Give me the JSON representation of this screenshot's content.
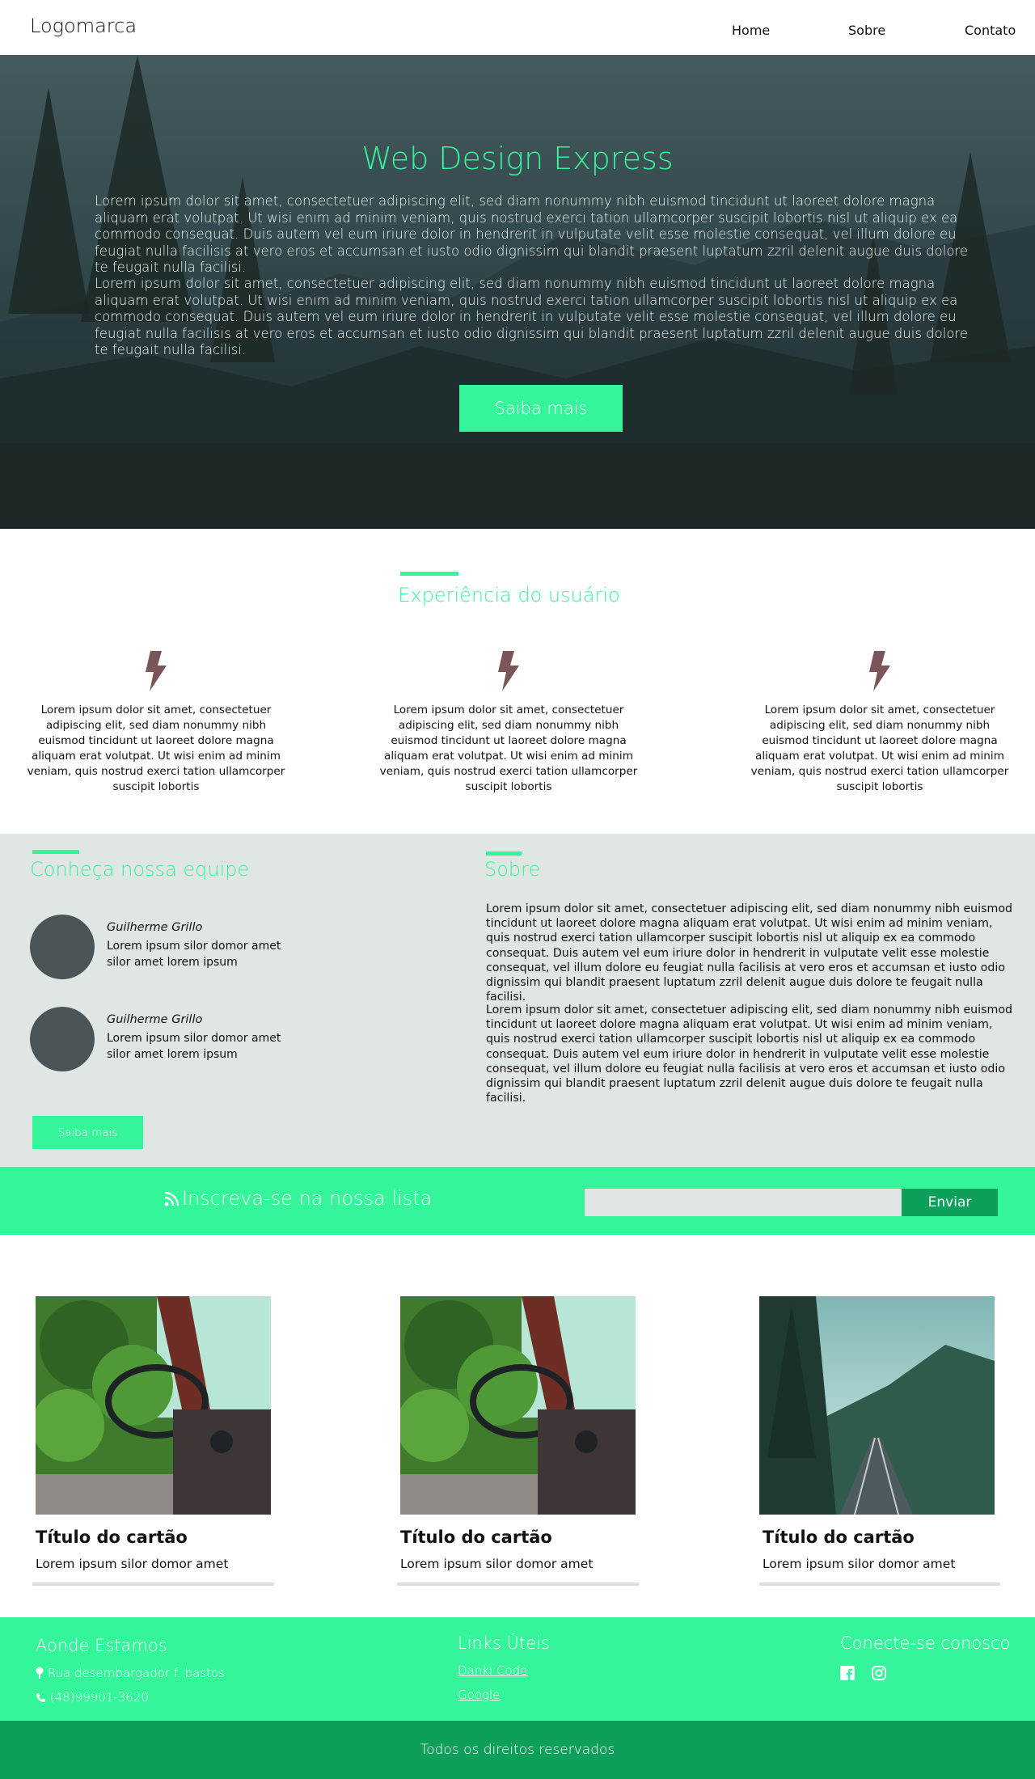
{
  "header": {
    "logo": "Logomarca",
    "nav": [
      "Home",
      "Sobre",
      "Contato"
    ]
  },
  "hero": {
    "title": "Web Design Express",
    "paragraphs": [
      "Lorem ipsum dolor sit amet, consectetuer adipiscing elit, sed diam nonummy nibh euismod tincidunt ut laoreet dolore magna aliquam erat volutpat. Ut wisi enim ad minim veniam, quis nostrud exerci tation ullamcorper suscipit lobortis nisl ut aliquip ex ea commodo consequat. Duis autem vel eum iriure dolor in hendrerit in vulputate velit esse molestie consequat, vel illum dolore eu feugiat nulla facilisis at vero eros et accumsan et iusto odio dignissim qui blandit praesent luptatum zzril delenit augue duis dolore te feugait nulla facilisi.",
      "Lorem ipsum dolor sit amet, consectetuer adipiscing elit, sed diam nonummy nibh euismod tincidunt ut laoreet dolore magna aliquam erat volutpat. Ut wisi enim ad minim veniam, quis nostrud exerci tation ullamcorper suscipit lobortis nisl ut aliquip ex ea commodo consequat. Duis autem vel eum iriure dolor in hendrerit in vulputate velit esse molestie consequat, vel illum dolore eu feugiat nulla facilisis at vero eros et accumsan et iusto odio dignissim qui blandit praesent luptatum zzril delenit augue duis dolore te feugait nulla facilisi."
    ],
    "button": "Saiba mais"
  },
  "experience": {
    "title": "Experiência do usuário",
    "icon": "lightning-bolt-icon",
    "items": [
      "Lorem ipsum dolor sit amet, consectetuer adipiscing elit, sed diam nonummy nibh euismod tincidunt ut laoreet dolore magna aliquam erat volutpat. Ut wisi enim ad minim veniam, quis nostrud exerci tation ullamcorper suscipit lobortis",
      "Lorem ipsum dolor sit amet, consectetuer adipiscing elit, sed diam nonummy nibh euismod tincidunt ut laoreet dolore magna aliquam erat volutpat. Ut wisi enim ad minim veniam, quis nostrud exerci tation ullamcorper suscipit lobortis",
      "Lorem ipsum dolor sit amet, consectetuer adipiscing elit, sed diam nonummy nibh euismod tincidunt ut laoreet dolore magna aliquam erat volutpat. Ut wisi enim ad minim veniam, quis nostrud exerci tation ullamcorper suscipit lobortis"
    ]
  },
  "team": {
    "title": "Conheça nossa equipe",
    "members": [
      {
        "name": "Guilherme Grillo",
        "desc": "Lorem ipsum silor domor amet silor amet lorem ipsum"
      },
      {
        "name": "Guilherme Grillo",
        "desc": "Lorem ipsum silor domor amet silor amet lorem ipsum"
      }
    ],
    "button": "Saiba mais"
  },
  "about": {
    "title": "Sobre",
    "paragraphs": [
      "Lorem ipsum dolor sit amet, consectetuer adipiscing elit, sed diam nonummy nibh euismod tincidunt ut laoreet dolore magna aliquam erat volutpat. Ut wisi enim ad minim veniam, quis nostrud exerci tation ullamcorper suscipit lobortis nisl ut aliquip ex ea commodo consequat. Duis autem vel eum iriure dolor in hendrerit in vulputate velit esse molestie consequat, vel illum dolore eu feugiat nulla facilisis at vero eros et accumsan et iusto odio dignissim qui blandit praesent luptatum zzril delenit augue duis dolore te feugait nulla facilisi.",
      "Lorem ipsum dolor sit amet, consectetuer adipiscing elit, sed diam nonummy nibh euismod tincidunt ut laoreet dolore magna aliquam erat volutpat. Ut wisi enim ad minim veniam, quis nostrud exerci tation ullamcorper suscipit lobortis nisl ut aliquip ex ea commodo consequat. Duis autem vel eum iriure dolor in hendrerit in vulputate velit esse molestie consequat, vel illum dolore eu feugiat nulla facilisis at vero eros et accumsan et iusto odio dignissim qui blandit praesent luptatum zzril delenit augue duis dolore te feugait nulla facilisi."
    ]
  },
  "newsletter": {
    "icon": "rss-icon",
    "text": "Inscreva-se na nossa lista",
    "input_value": "",
    "button": "Enviar"
  },
  "cards": [
    {
      "title": "Título do cartão",
      "text": "Lorem ipsum silor domor amet",
      "image": "truck-interior-photo"
    },
    {
      "title": "Título do cartão",
      "text": "Lorem ipsum silor domor amet",
      "image": "truck-interior-photo"
    },
    {
      "title": "Título do cartão",
      "text": "Lorem ipsum silor domor amet",
      "image": "railway-bridge-forest-photo"
    }
  ],
  "footer": {
    "location": {
      "title": "Aonde Estamos",
      "address": "Rua desembargador f. bastos",
      "phone": "(48)99901-3620"
    },
    "links": {
      "title": "Links Úteis",
      "items": [
        "Danki Code",
        "Google"
      ]
    },
    "social": {
      "title": "Conecte-se conosco",
      "icons": [
        "facebook-icon",
        "instagram-icon"
      ]
    },
    "copyright": "Todos os direitos reservados"
  },
  "colors": {
    "accent": "#35f59a",
    "dark_accent": "#0ea05a",
    "gray_bg": "#e0e6e3",
    "icon_brown": "#7b5559",
    "avatar": "#4a5557"
  }
}
